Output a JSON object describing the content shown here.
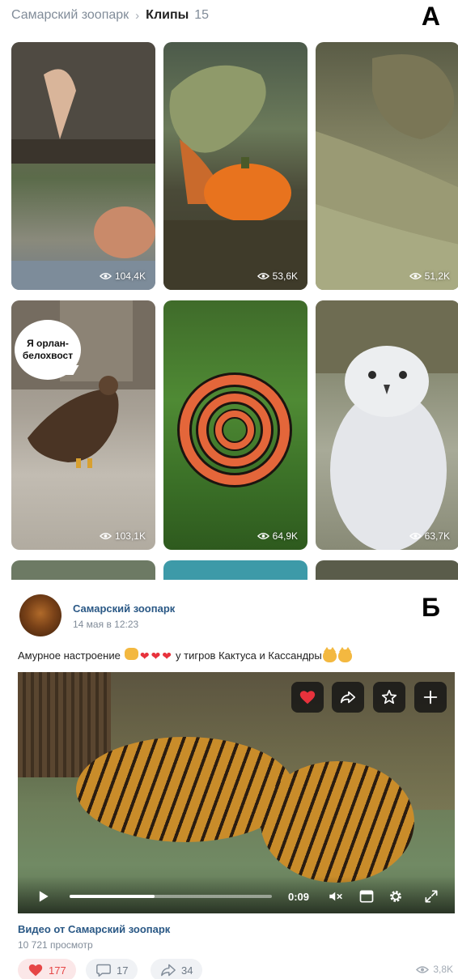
{
  "panel_a": {
    "letter": "А",
    "breadcrumb": {
      "group": "Самарский зоопарк",
      "separator": "›",
      "section": "Клипы",
      "count": "15"
    },
    "clips": [
      {
        "views": "104,4K"
      },
      {
        "views": "53,6K"
      },
      {
        "views": "51,2K"
      },
      {
        "views": "103,1K",
        "overlay_text": "Я орлан-белохвост"
      },
      {
        "views": "64,9K"
      },
      {
        "views": "63,7K"
      }
    ]
  },
  "panel_b": {
    "letter": "Б",
    "post": {
      "author": "Самарский зоопарк",
      "date": "14 мая в 12:23",
      "text_start": "Амурное настроение",
      "text_end": "у тигров Кактуса и Кассандры"
    },
    "video": {
      "time": "0:09",
      "progress": 0.42,
      "source": "Видео от Самарский зоопарк",
      "views": "10 721 просмотр"
    },
    "actions": {
      "likes": "177",
      "comments": "17",
      "shares": "34",
      "views": "3,8K"
    }
  },
  "colors": {
    "link": "#2a5885",
    "like_red": "#e64646",
    "muted": "#818c99"
  }
}
